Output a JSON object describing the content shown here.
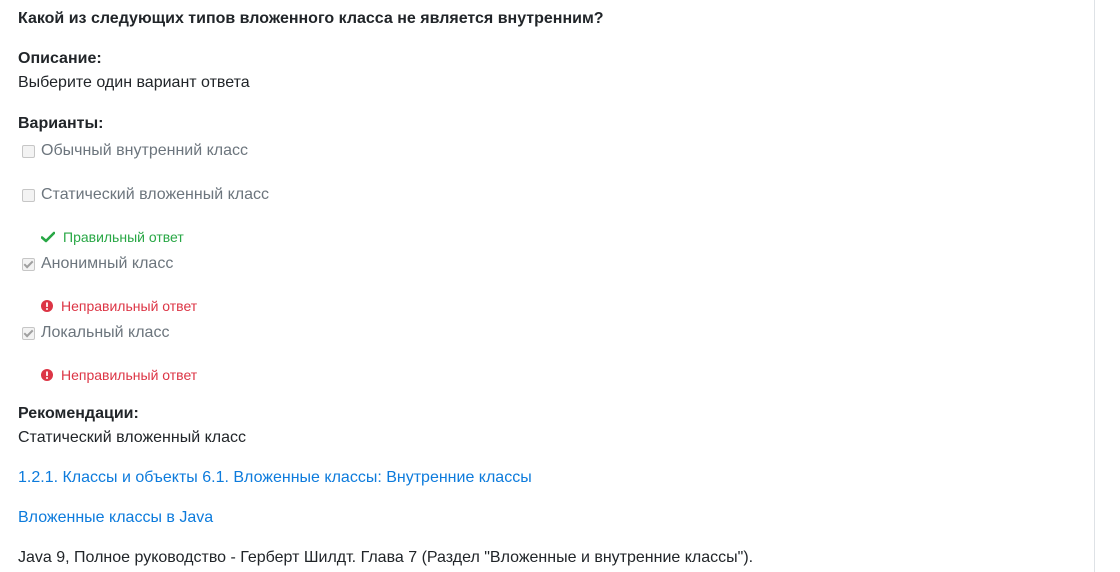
{
  "question": "Какой из следующих типов вложенного класса не является внутренним?",
  "description": {
    "heading": "Описание:",
    "text": "Выберите один вариант ответа"
  },
  "options_heading": "Варианты:",
  "options": [
    {
      "label": "Обычный внутренний класс",
      "checked": false,
      "feedback": ""
    },
    {
      "label": "Статический вложенный класс",
      "checked": false,
      "feedback": "Правильный ответ"
    },
    {
      "label": "Анонимный класс",
      "checked": true,
      "feedback": "Неправильный ответ"
    },
    {
      "label": "Локальный класс",
      "checked": true,
      "feedback": "Неправильный ответ"
    }
  ],
  "recommendations": {
    "heading": "Рекомендации:",
    "answer": "Статический вложенный класс",
    "link1": "1.2.1. Классы и объекты 6.1. Вложенные классы: Внутренние классы",
    "link2": "Вложенные классы в Java",
    "reference": "Java 9, Полное руководство - Герберт Шилдт. Глава 7 (Раздел \"Вложенные и внутренние классы\")."
  },
  "colors": {
    "correct": "#28a745",
    "incorrect": "#dc3545",
    "link": "#0d7bdc"
  }
}
